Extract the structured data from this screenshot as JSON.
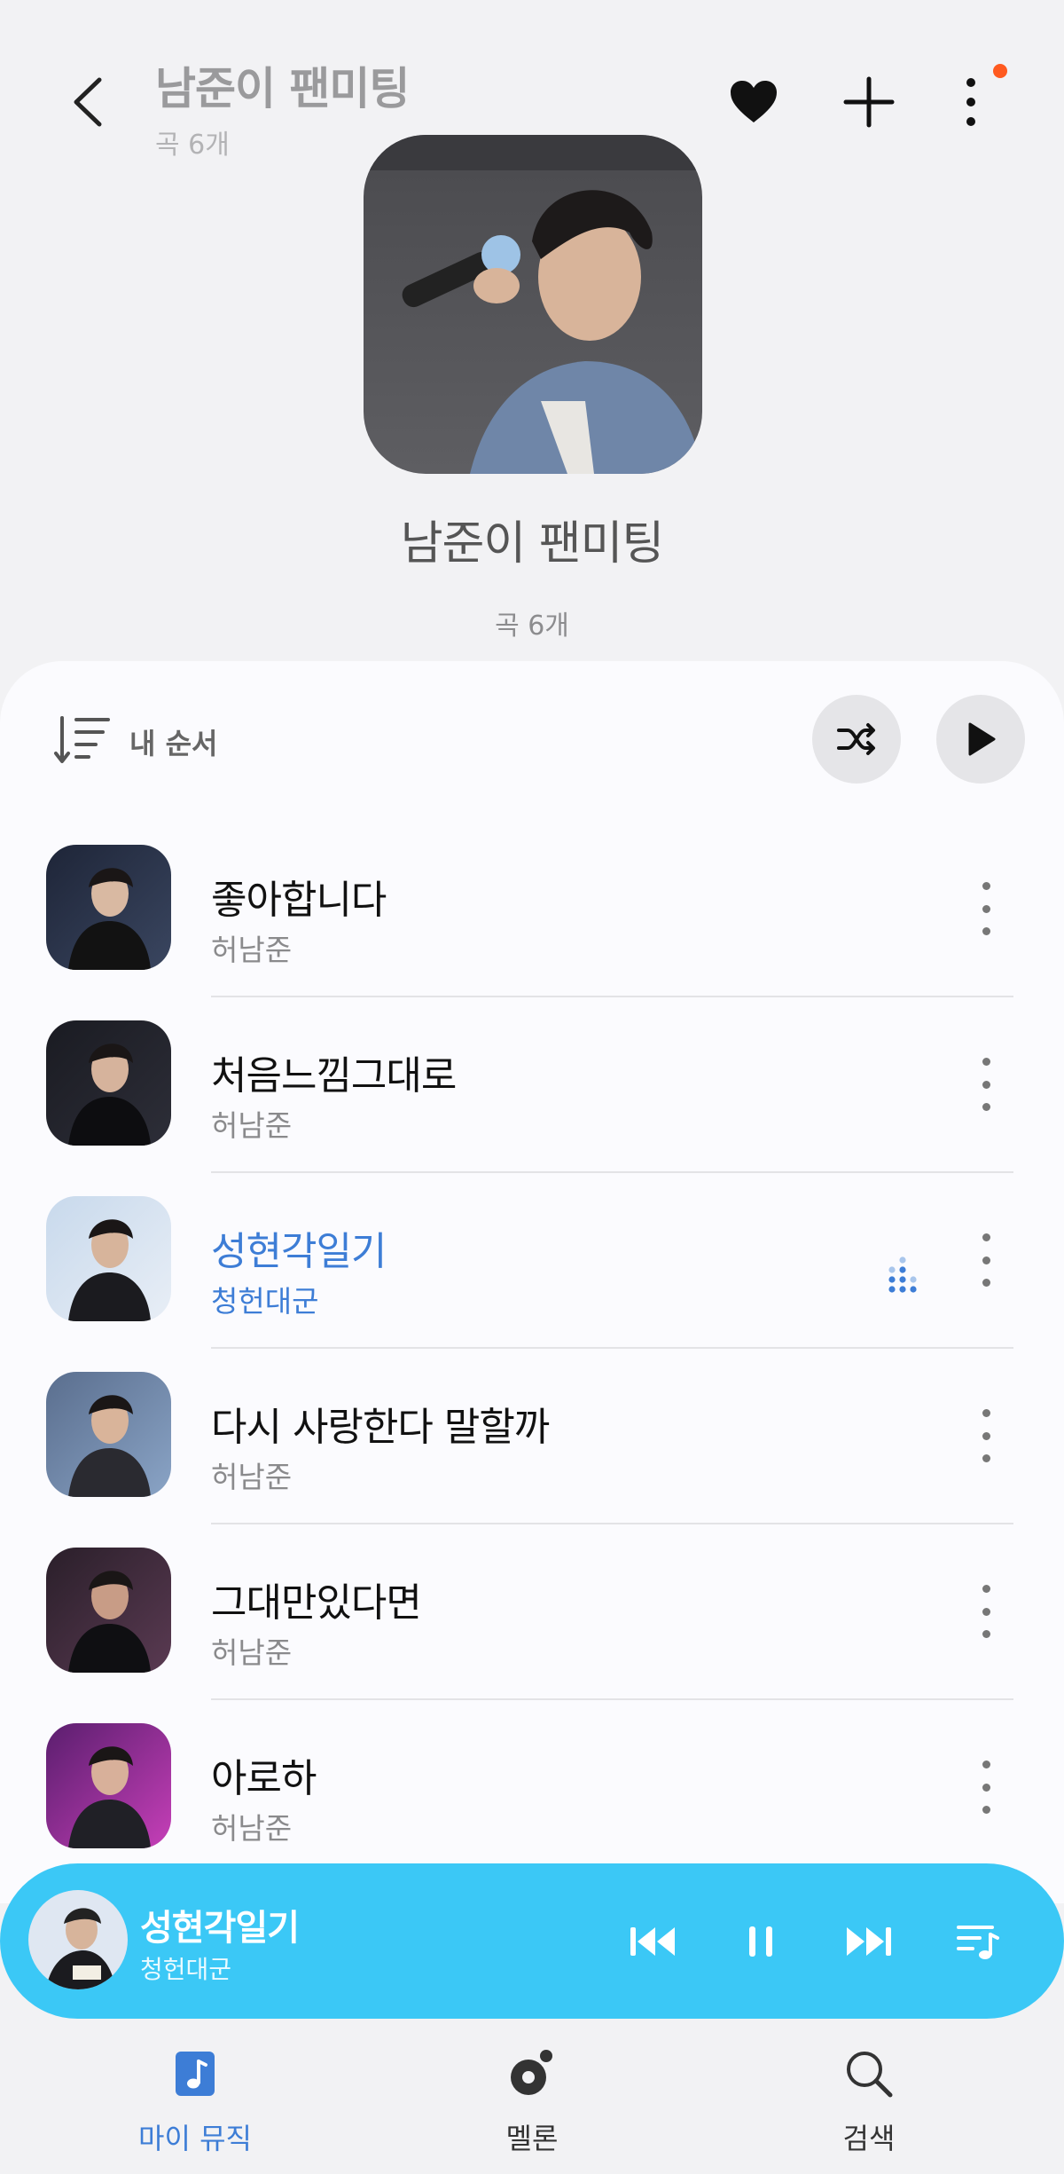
{
  "header": {
    "title": "남준이 팬미팅",
    "subtitle": "곡 6개"
  },
  "playlist": {
    "title": "남준이 팬미팅",
    "count": "곡 6개"
  },
  "sort": {
    "label": "내 순서"
  },
  "tracks": [
    {
      "title": "좋아합니다",
      "artist": "허남준",
      "active": false
    },
    {
      "title": "처음느낌그대로",
      "artist": "허남준",
      "active": false
    },
    {
      "title": "성현각일기",
      "artist": "청헌대군",
      "active": true
    },
    {
      "title": "다시 사랑한다 말할까",
      "artist": "허남준",
      "active": false
    },
    {
      "title": "그대만있다면",
      "artist": "허남준",
      "active": false
    },
    {
      "title": "아로하",
      "artist": "허남준",
      "active": false
    }
  ],
  "now_playing": {
    "title": "성현각일기",
    "artist": "청헌대군"
  },
  "nav": {
    "items": [
      {
        "label": "마이 뮤직",
        "icon": "music-note-icon",
        "active": true
      },
      {
        "label": "멜론",
        "icon": "melon-icon",
        "active": false
      },
      {
        "label": "검색",
        "icon": "search-icon",
        "active": false
      }
    ]
  },
  "colors": {
    "accent": "#3d7dd6",
    "mini_player": "#3bc8f6",
    "notification": "#ff5a1f"
  }
}
